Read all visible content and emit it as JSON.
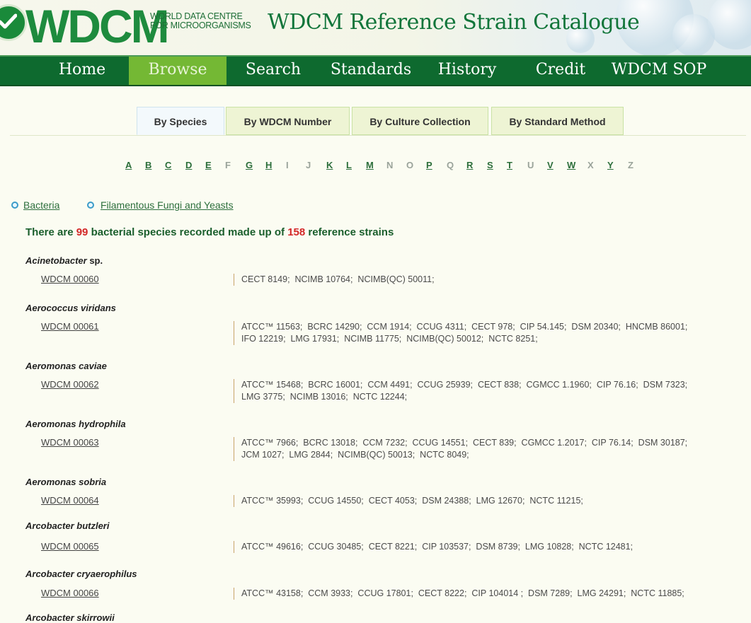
{
  "header": {
    "logo_text": "WDCM",
    "logo_sub_line1": "WORLD DATA CENTRE",
    "logo_sub_line2": "FOR MICROORGANISMS",
    "title": "WDCM Reference Strain Catalogue"
  },
  "nav": {
    "items": [
      {
        "label": "Home",
        "active": false
      },
      {
        "label": "Browse",
        "active": true
      },
      {
        "label": "Search",
        "active": false
      },
      {
        "label": "Standards",
        "active": false
      },
      {
        "label": "History",
        "active": false
      },
      {
        "label": "Credit",
        "active": false
      },
      {
        "label": "WDCM SOP",
        "active": false
      }
    ]
  },
  "tabs": [
    {
      "label": "By Species",
      "active": true
    },
    {
      "label": "By WDCM Number",
      "active": false
    },
    {
      "label": "By Culture Collection",
      "active": false
    },
    {
      "label": "By Standard Method",
      "active": false
    }
  ],
  "alphabet": [
    {
      "letter": "A",
      "link": true
    },
    {
      "letter": "B",
      "link": true
    },
    {
      "letter": "C",
      "link": true
    },
    {
      "letter": "D",
      "link": true
    },
    {
      "letter": "E",
      "link": true
    },
    {
      "letter": "F",
      "link": false
    },
    {
      "letter": "G",
      "link": true
    },
    {
      "letter": "H",
      "link": true
    },
    {
      "letter": "I",
      "link": false
    },
    {
      "letter": "J",
      "link": false
    },
    {
      "letter": "K",
      "link": true
    },
    {
      "letter": "L",
      "link": true
    },
    {
      "letter": "M",
      "link": true
    },
    {
      "letter": "N",
      "link": false
    },
    {
      "letter": "O",
      "link": false
    },
    {
      "letter": "P",
      "link": true
    },
    {
      "letter": "Q",
      "link": false
    },
    {
      "letter": "R",
      "link": true
    },
    {
      "letter": "S",
      "link": true
    },
    {
      "letter": "T",
      "link": true
    },
    {
      "letter": "U",
      "link": false
    },
    {
      "letter": "V",
      "link": true
    },
    {
      "letter": "W",
      "link": true
    },
    {
      "letter": "X",
      "link": false
    },
    {
      "letter": "Y",
      "link": true
    },
    {
      "letter": "Z",
      "link": false
    }
  ],
  "categories": [
    {
      "label": "Bacteria",
      "icon": "radio-dot-icon"
    },
    {
      "label": "Filamentous Fungi and Yeasts",
      "icon": "radio-dot-icon"
    }
  ],
  "summary": {
    "prefix": "There are ",
    "species_count": "99",
    "middle": " bacterial species recorded made up of ",
    "strain_count": "158",
    "suffix": " reference strains"
  },
  "species": [
    {
      "name": "Acinetobacter",
      "suffix": " sp.",
      "wdcm": "WDCM 00060",
      "strains": [
        "CECT 8149;  NCIMB 10764;  NCIMB(QC) 50011;"
      ]
    },
    {
      "name": "Aerococcus viridans",
      "suffix": "",
      "wdcm": "WDCM 00061",
      "strains": [
        "ATCC™ 11563;  BCRC 14290;  CCM 1914;  CCUG 4311;  CECT 978;  CIP 54.145;  DSM 20340;  HNCMB 86001;",
        "IFO 12219;  LMG 17931;  NCIMB 11775;  NCIMB(QC) 50012;  NCTC 8251;"
      ]
    },
    {
      "name": "Aeromonas caviae",
      "suffix": "",
      "wdcm": "WDCM 00062",
      "strains": [
        "ATCC™ 15468;  BCRC 16001;  CCM 4491;  CCUG 25939;  CECT 838;  CGMCC 1.1960;  CIP 76.16;  DSM 7323;",
        "LMG 3775;  NCIMB 13016;  NCTC 12244;"
      ]
    },
    {
      "name": "Aeromonas hydrophila",
      "suffix": "",
      "wdcm": "WDCM 00063",
      "strains": [
        "ATCC™ 7966;  BCRC 13018;  CCM 7232;  CCUG 14551;  CECT 839;  CGMCC 1.2017;  CIP 76.14;  DSM 30187;",
        "JCM 1027;  LMG 2844;  NCIMB(QC) 50013;  NCTC 8049;"
      ]
    },
    {
      "name": "Aeromonas sobria",
      "suffix": "",
      "wdcm": "WDCM 00064",
      "strains": [
        "ATCC™ 35993;  CCUG 14550;  CECT 4053;  DSM 24388;  LMG 12670;  NCTC 11215;"
      ]
    },
    {
      "name": "Arcobacter butzleri",
      "suffix": "",
      "wdcm": "WDCM 00065",
      "strains": [
        "ATCC™ 49616;  CCUG 30485;  CECT 8221;  CIP 103537;  DSM 8739;  LMG 10828;  NCTC 12481;"
      ]
    },
    {
      "name": "Arcobacter cryaerophilus",
      "suffix": "",
      "wdcm": "WDCM 00066",
      "strains": [
        "ATCC™ 43158;  CCM 3933;  CCUG 17801;  CECT 8222;  CIP 104014 ;  DSM 7289;  LMG 24291;  NCTC 11885;"
      ]
    },
    {
      "name": "Arcobacter skirrowii",
      "suffix": "",
      "wdcm": "",
      "strains": []
    }
  ]
}
